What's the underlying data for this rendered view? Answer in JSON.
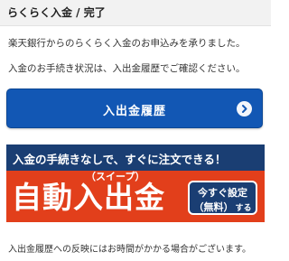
{
  "header": {
    "title": "らくらく入金 / 完了"
  },
  "messages": {
    "line1": "楽天銀行からのらくらく入金のお申込みを承りました。",
    "line2": "入金のお手続き状況は、入出金履歴でご確認ください。"
  },
  "history_button": {
    "label": "入出金履歴",
    "icon": "chevron-right-icon"
  },
  "banner": {
    "headline": "入金の手続きなしで、すぐに注文できる！",
    "ruby": "（スイープ）",
    "title": "自動入出金",
    "cta_line1": "今すぐ設定",
    "cta_line2": "（無料）",
    "cta_suffix": "する",
    "colors": {
      "navy": "#1a3e73",
      "orange": "#e23f1b"
    }
  },
  "footer_note": "入出金履歴への反映にはお時間がかかる場合がございます。",
  "colors": {
    "primary_button": "#1257b4",
    "header_bg": "#f2f2f2"
  }
}
